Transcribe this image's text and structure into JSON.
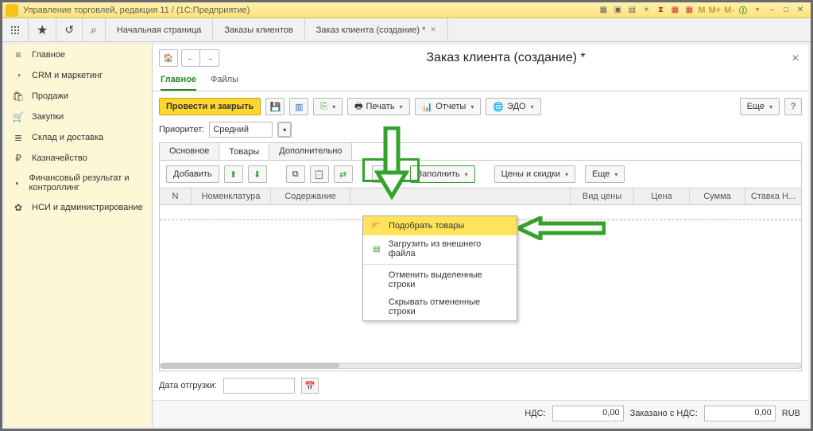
{
  "titlebar": {
    "title": "Управление торговлей, редакция 11 / (1С:Предприятие)"
  },
  "top_tabs": {
    "home": "Начальная страница",
    "orders": "Заказы клиентов",
    "active": "Заказ клиента (создание) *"
  },
  "sidebar": {
    "items": [
      {
        "label": "Главное",
        "icon": "≡"
      },
      {
        "label": "CRM и маркетинг",
        "icon": "◔"
      },
      {
        "label": "Продажи",
        "icon": "🛍"
      },
      {
        "label": "Закупки",
        "icon": "🛒"
      },
      {
        "label": "Склад и доставка",
        "icon": "≣"
      },
      {
        "label": "Казначейство",
        "icon": "₽"
      },
      {
        "label": "Финансовый результат и контроллинг",
        "icon": "⬪"
      },
      {
        "label": "НСИ и администрирование",
        "icon": "✿"
      }
    ]
  },
  "page": {
    "title": "Заказ клиента (создание) *"
  },
  "form_tabs": {
    "main": "Главное",
    "files": "Файлы"
  },
  "cmdbar": {
    "post_close": "Провести и закрыть",
    "print": "Печать",
    "reports": "Отчеты",
    "edo": "ЭДО",
    "more": "Еще",
    "help": "?"
  },
  "priority": {
    "label": "Приоритет:",
    "value": "Средний"
  },
  "inner_tabs": {
    "basic": "Основное",
    "goods": "Товары",
    "extra": "Дополнительно"
  },
  "sub_toolbar": {
    "add": "Добавить",
    "fill": "Заполнить",
    "prices": "Цены и скидки",
    "more": "Еще"
  },
  "fill_menu": {
    "pick": "Подобрать товары",
    "load": "Загрузить из внешнего файла",
    "cancel_sel": "Отменить выделенные строки",
    "hide_canc": "Скрывать отмененные строки"
  },
  "table": {
    "n": "N",
    "nom": "Номенклатура",
    "cont": "Содержание",
    "vid": "Вид цены",
    "price": "Цена",
    "sum": "Сумма",
    "rate": "Ставка Н..."
  },
  "footer": {
    "ship_date": "Дата отгрузки:",
    "nds": "НДС:",
    "ordered_nds": "Заказано с НДС:",
    "zero": "0,00",
    "cur": "RUB"
  }
}
